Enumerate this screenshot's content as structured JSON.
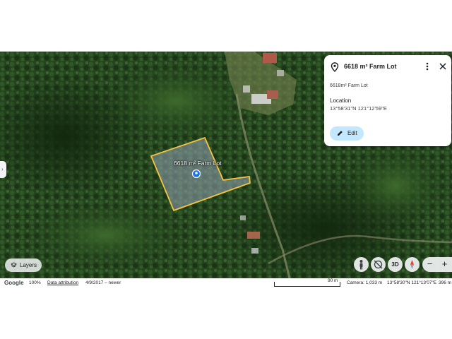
{
  "colors": {
    "polygon_outline": "#f6c343",
    "polygon_fill": "#8a9aa6",
    "accent_blue": "#1a73e8",
    "edit_button_bg": "#c2e7ff"
  },
  "map": {
    "polygon_label": "6618 m² Farm Lot",
    "polygon_icon": "location-pin-icon"
  },
  "panel": {
    "title": "6618 m² Farm Lot",
    "area_text": "6618m² Farm Lot",
    "location_label": "Location",
    "location_value": "13°58'31\"N 121°12'59\"E",
    "edit_label": "Edit",
    "icons": [
      "location-pin-icon",
      "more-vert-icon",
      "close-icon",
      "pencil-icon"
    ]
  },
  "controls": {
    "layers_label": "Layers",
    "three_d_label": "3D",
    "zoom_out": "−",
    "zoom_in": "+",
    "icons": [
      "pegman-icon",
      "rotate-icon",
      "compass-icon"
    ]
  },
  "status_bar": {
    "logo": "Google",
    "zoom": "100%",
    "data_attribution": "Data attribution",
    "imagery_date": "4/9/2017 – newer",
    "scale_label": "90 m",
    "camera": "Camera: 1,033 m",
    "cursor_coords": "13°58'30\"N 121°13'07\"E",
    "elevation": "396 m"
  }
}
